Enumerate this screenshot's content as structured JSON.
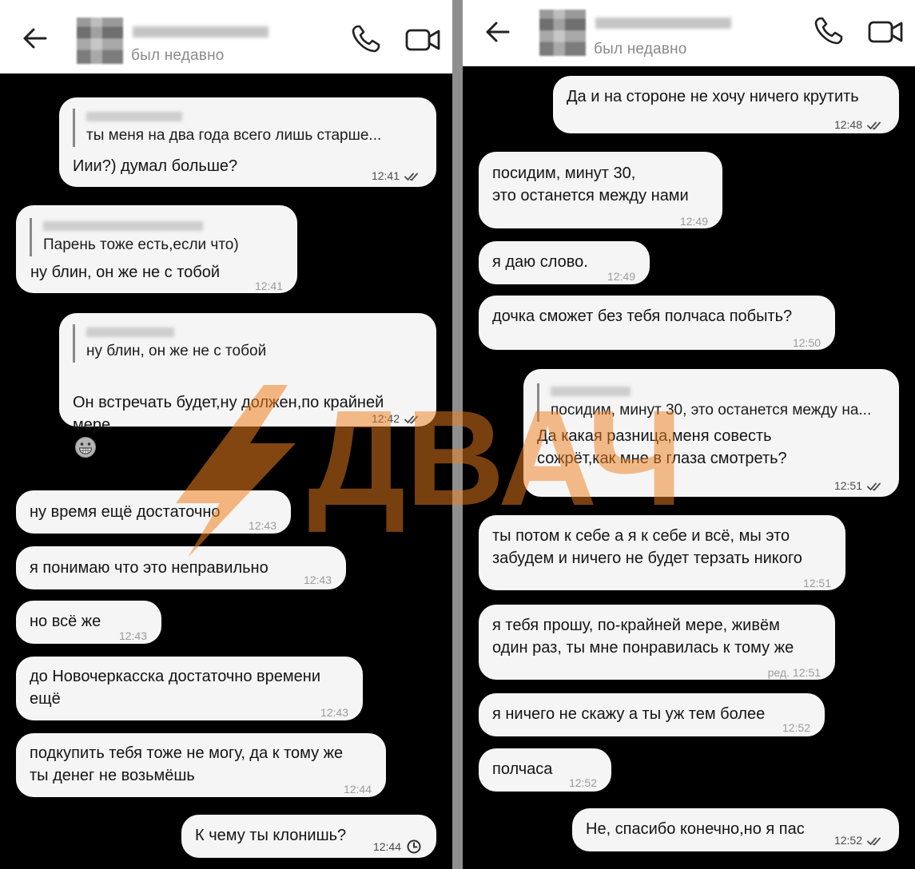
{
  "left": {
    "header": {
      "status": "был недавно"
    },
    "messages": [
      {
        "quote": "ты меня на два года всего лишь старше...",
        "text": "Иии?) думал больше?",
        "time": "12:41"
      },
      {
        "quote": "Парень тоже есть,если что)",
        "text": "ну блин, он же не с тобой",
        "time": "12:41"
      },
      {
        "quote": "ну блин, он же не с тобой",
        "text": "Он встречать будет,ну должен,по крайней\nмере",
        "time": "12:42"
      },
      {
        "text": "ну время ещё достаточно",
        "time": "12:43"
      },
      {
        "text": "я понимаю что это неправильно",
        "time": "12:43"
      },
      {
        "text": "но всё же",
        "time": "12:43"
      },
      {
        "text": "до Новочеркасска достаточно времени\nещё",
        "time": "12:43"
      },
      {
        "text": "подкупить тебя тоже не могу, да к тому же\nты денег не возьмёшь",
        "time": "12:44"
      },
      {
        "text": "К чему ты клонишь?",
        "time": "12:44"
      }
    ]
  },
  "right": {
    "header": {
      "status": "был недавно"
    },
    "messages": [
      {
        "text": "Да и на стороне не хочу ничего крутить",
        "time": "12:48"
      },
      {
        "text": "посидим, минут 30,\nэто останется между нами",
        "time": "12:49"
      },
      {
        "text": "я даю слово.",
        "time": "12:49"
      },
      {
        "text": "дочка сможет без тебя полчаса побыть?",
        "time": "12:50"
      },
      {
        "quote": "посидим, минут 30, это останется между на...",
        "text": "Да какая разница,меня совесть\nсожрёт,как мне в глаза смотреть?",
        "time": "12:51"
      },
      {
        "text": "ты потом к себе а я к себе и всё, мы это\nзабудем и ничего не будет терзать никого",
        "time": "12:51"
      },
      {
        "text": "я тебя прошу, по-крайней мере, живём\nодин раз, ты мне понравилась к тому же",
        "time": "ред. 12:51"
      },
      {
        "text": "я ничего не скажу а ты уж тем более",
        "time": "12:52"
      },
      {
        "text": "полчаса",
        "time": "12:52"
      },
      {
        "text": "Не, спасибо конечно,но я пас",
        "time": "12:52"
      }
    ]
  },
  "icons": {
    "back": "arrow-left-icon",
    "call": "phone-icon",
    "video": "video-camera-icon",
    "read": "double-check-icon",
    "pending": "clock-icon",
    "emoji": "grinning-face-emoji"
  },
  "colors": {
    "background": "#000000",
    "bubble": "#f5f5f5",
    "header": "#ffffff",
    "watermark": "#f07f1e"
  },
  "watermark": {
    "text": "ДВАЧ"
  }
}
